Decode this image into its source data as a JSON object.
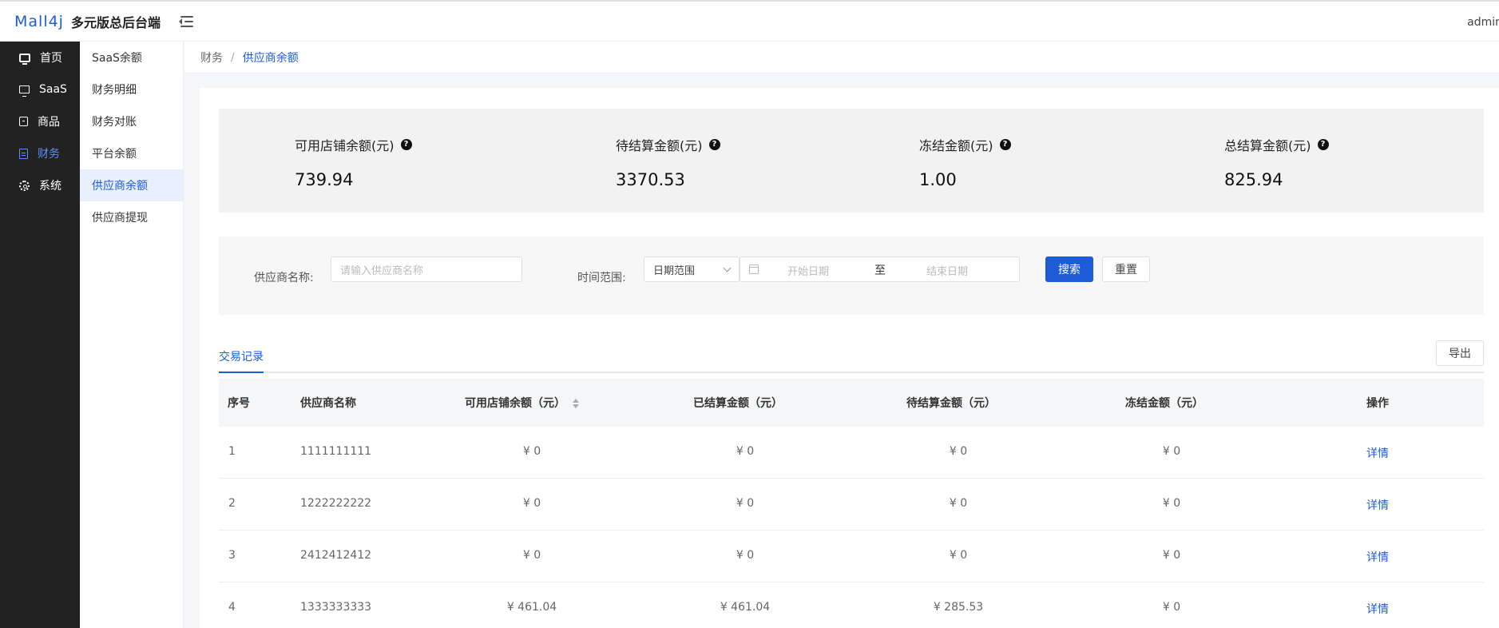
{
  "header": {
    "logo_mark": "Mall4j",
    "logo_text": "多元版总后台端",
    "user": "admin"
  },
  "sidebar": {
    "items": [
      {
        "label": "首页",
        "icon": "home-icon"
      },
      {
        "label": "SaaS",
        "icon": "monitor-icon"
      },
      {
        "label": "商品",
        "icon": "goods-icon"
      },
      {
        "label": "财务",
        "icon": "finance-icon",
        "active": true
      },
      {
        "label": "系统",
        "icon": "settings-icon"
      }
    ]
  },
  "subnav": {
    "items": [
      {
        "label": "SaaS余额"
      },
      {
        "label": "财务明细"
      },
      {
        "label": "财务对账"
      },
      {
        "label": "平台余额"
      },
      {
        "label": "供应商余额",
        "active": true
      },
      {
        "label": "供应商提现"
      }
    ]
  },
  "breadcrumb": {
    "parent": "财务",
    "separator": "/",
    "current": "供应商余额"
  },
  "stats": [
    {
      "label": "可用店铺余额(元)",
      "value": "739.94"
    },
    {
      "label": "待结算金额(元)",
      "value": "3370.53"
    },
    {
      "label": "冻结金额(元)",
      "value": "1.00"
    },
    {
      "label": "总结算金额(元)",
      "value": "825.94"
    }
  ],
  "filter": {
    "supplier_label": "供应商名称:",
    "supplier_placeholder": "请输入供应商名称",
    "time_label": "时间范围:",
    "time_select": "日期范围",
    "start_placeholder": "开始日期",
    "range_to": "至",
    "end_placeholder": "结束日期",
    "search_label": "搜索",
    "reset_label": "重置"
  },
  "tabs": {
    "active": "交易记录",
    "export_label": "导出"
  },
  "table": {
    "columns": [
      "序号",
      "供应商名称",
      "可用店铺余额（元）",
      "已结算金额（元）",
      "待结算金额（元）",
      "冻结金额（元）",
      "操作"
    ],
    "rows": [
      {
        "index": "1",
        "name": "1111111111",
        "available": "¥ 0",
        "settled": "¥ 0",
        "pending": "¥ 0",
        "frozen": "¥ 0",
        "action": "详情"
      },
      {
        "index": "2",
        "name": "1222222222",
        "available": "¥ 0",
        "settled": "¥ 0",
        "pending": "¥ 0",
        "frozen": "¥ 0",
        "action": "详情"
      },
      {
        "index": "3",
        "name": "2412412412",
        "available": "¥ 0",
        "settled": "¥ 0",
        "pending": "¥ 0",
        "frozen": "¥ 0",
        "action": "详情"
      },
      {
        "index": "4",
        "name": "1333333333",
        "available": "¥ 461.04",
        "settled": "¥ 461.04",
        "pending": "¥ 285.53",
        "frozen": "¥ 0",
        "action": "详情"
      }
    ]
  },
  "colors": {
    "primary": "#1e5bd6",
    "sidebar_bg": "#222222",
    "sidebar_active": "#5b8ff9"
  }
}
